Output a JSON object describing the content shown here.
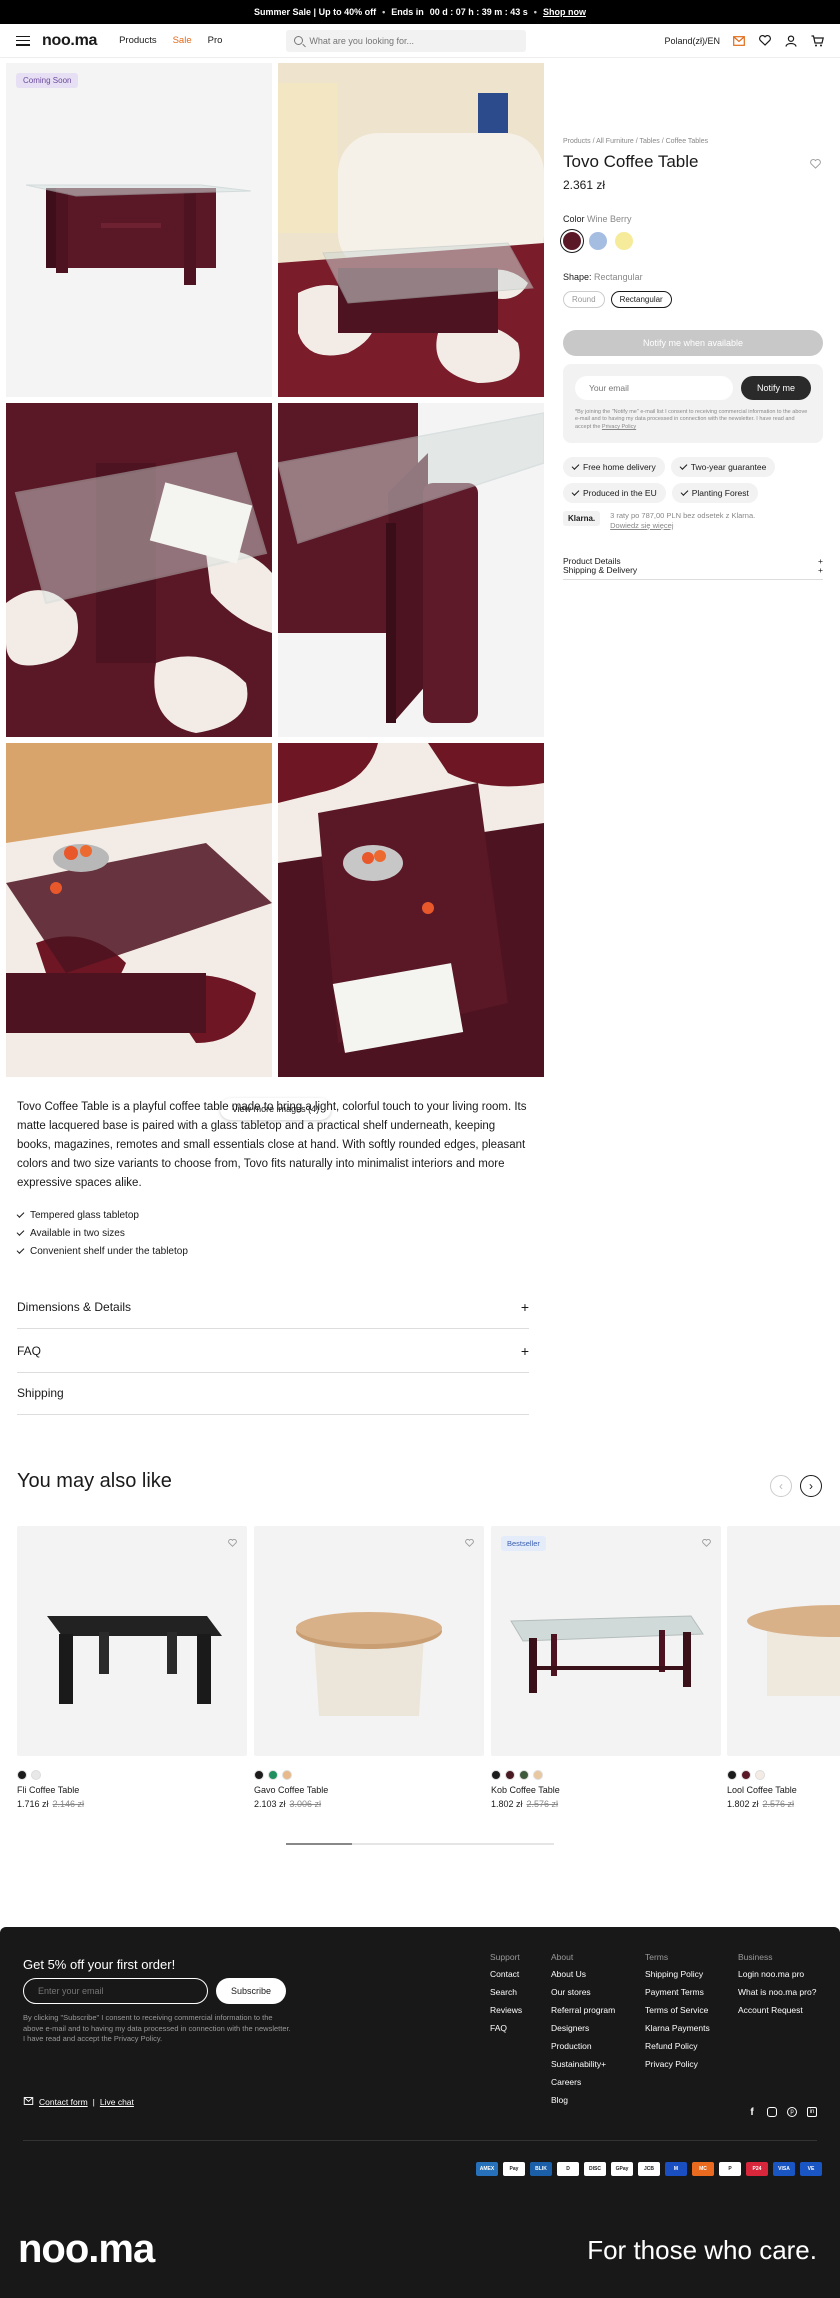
{
  "banner": {
    "sale": "Summer Sale | Up to 40% off",
    "bullet": "•",
    "ends": "Ends in",
    "timer": "00 d : 07 h : 39 m : 43 s",
    "shop": "Shop now"
  },
  "header": {
    "logo": "noo.ma",
    "nav": [
      "Products",
      "Sale",
      "Pro"
    ],
    "search_placeholder": "What are you looking for...",
    "locale": "Poland(zł)/EN"
  },
  "gallery": {
    "badge": "Coming Soon",
    "view_more": "View more images (4)"
  },
  "product": {
    "breadcrumb": "Products / All Furniture / Tables / Coffee Tables",
    "title": "Tovo Coffee Table",
    "price": "2.361 zł",
    "color_label": "Color",
    "color_value": "Wine Berry",
    "colors": [
      "#5a1826",
      "#a6bde2",
      "#f6eb9a"
    ],
    "shape_label": "Shape:",
    "shape_value": "Rectangular",
    "shapes": [
      "Round",
      "Rectangular"
    ],
    "notify_available": "Notify me when available",
    "email_placeholder": "Your email",
    "notify_me": "Notify me",
    "consent": "*By joining the \"Notify me\" e-mail list I consent to receiving commercial information to the above e-mail and to having my data processed in connection with the newsletter. I have read and accept the",
    "privacy": "Privacy Policy",
    "features": [
      "Free home delivery",
      "Two-year guarantee",
      "Produced in the EU",
      "Planting Forest"
    ],
    "klarna": "Klarna.",
    "klarna_text": "3 raty po 787,00 PLN bez odsetek z Klarna.",
    "klarna_link": "Dowiedz się więcej",
    "details": [
      "Product Details",
      "Shipping & Delivery"
    ]
  },
  "description": {
    "text": "Tovo Coffee Table is a playful coffee table made to bring a light, colorful touch to your living room. Its matte lacquered base is paired with a glass tabletop and a practical shelf underneath, keeping books, magazines, remotes and small essentials close at hand. With softly rounded edges, pleasant colors and two size variants to choose from, Tovo fits naturally into minimalist interiors and more expressive spaces alike.",
    "bullets": [
      "Tempered glass tabletop",
      "Available in two sizes",
      "Convenient shelf under the tabletop"
    ]
  },
  "accordions": [
    "Dimensions & Details",
    "FAQ",
    "Shipping"
  ],
  "recommendations": {
    "title": "You may also like",
    "bestseller": "Bestseller",
    "items": [
      {
        "name": "Fli Coffee Table",
        "price": "1.716 zł",
        "old": "2.146 zł",
        "colors": [
          "#1b1b1b",
          "#e8e8e8"
        ]
      },
      {
        "name": "Gavo Coffee Table",
        "price": "2.103 zł",
        "old": "3.006 zł",
        "colors": [
          "#1b1b1b",
          "#1f8f5e",
          "#e8b98a"
        ]
      },
      {
        "name": "Kob Coffee Table",
        "price": "1.802 zł",
        "old": "2.576 zł",
        "colors": [
          "#1b1b1b",
          "#4a1a22",
          "#3e5a3a",
          "#e8c8a0"
        ]
      },
      {
        "name": "Lool Coffee Table",
        "price": "1.802 zł",
        "old": "2.576 zł",
        "colors": [
          "#1b1b1b",
          "#5a1826",
          "#f4ece4"
        ]
      }
    ]
  },
  "footer": {
    "promo": "Get 5% off your first order!",
    "email_placeholder": "Enter your email",
    "subscribe": "Subscribe",
    "consent": "By clicking \"Subscribe\" I consent to receiving commercial information to the above e-mail and to having my data processed in connection with the newsletter. I have read and accept the Privacy Policy.",
    "support": {
      "title": "Support",
      "items": [
        "Contact",
        "Search",
        "Reviews",
        "FAQ"
      ]
    },
    "about": {
      "title": "About",
      "items": [
        "About Us",
        "Our stores",
        "Referral program",
        "Designers",
        "Production",
        "Sustainability+",
        "Careers",
        "Blog"
      ]
    },
    "terms": {
      "title": "Terms",
      "items": [
        "Shipping Policy",
        "Payment Terms",
        "Terms of Service",
        "Klarna Payments",
        "Refund Policy",
        "Privacy Policy"
      ]
    },
    "business": {
      "title": "Business",
      "items": [
        "Login noo.ma pro",
        "What is noo.ma pro?",
        "Account Request"
      ]
    },
    "contact_form": "Contact form",
    "live_chat": "Live chat",
    "payments": [
      {
        "label": "AMEX",
        "color": "#2671b9"
      },
      {
        "label": "Pay",
        "color": "#ffffff"
      },
      {
        "label": "BLIK",
        "color": "#1b5fa8"
      },
      {
        "label": "D",
        "color": "#ffffff"
      },
      {
        "label": "DISC",
        "color": "#ffffff"
      },
      {
        "label": "GPay",
        "color": "#ffffff"
      },
      {
        "label": "JCB",
        "color": "#ffffff"
      },
      {
        "label": "M",
        "color": "#1a4fc1"
      },
      {
        "label": "MC",
        "color": "#ea6a1f"
      },
      {
        "label": "P",
        "color": "#ffffff"
      },
      {
        "label": "P24",
        "color": "#d8263b"
      },
      {
        "label": "VISA",
        "color": "#1a55c4"
      },
      {
        "label": "VE",
        "color": "#1a55c4"
      }
    ],
    "logo": "noo.ma",
    "tagline": "For those who care."
  }
}
